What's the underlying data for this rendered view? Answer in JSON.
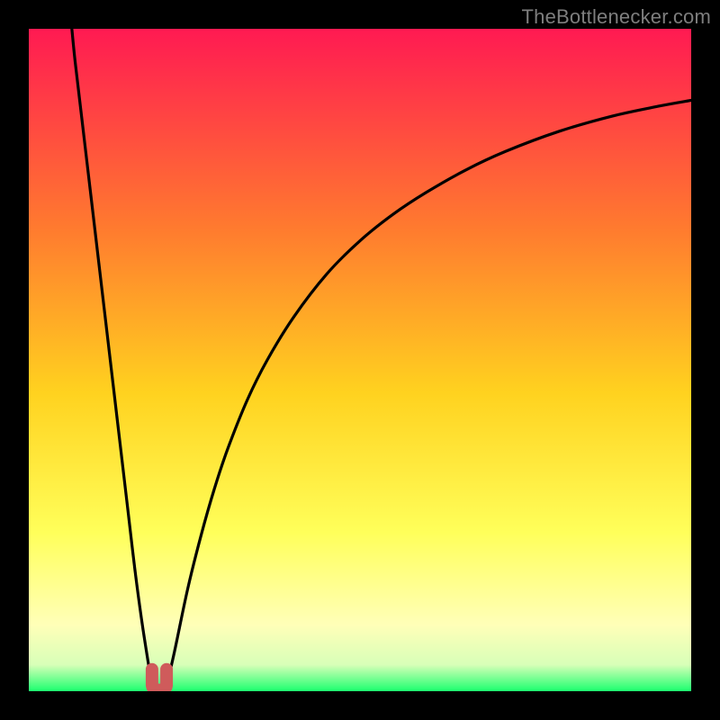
{
  "credit": "TheBottlenecker.com",
  "colors": {
    "frame": "#000000",
    "curve": "#000000",
    "marker_fill": "#cf5b5b",
    "marker_stroke": "#cf5b5b",
    "gradient_top": "#ff1a52",
    "gradient_mid1": "#ff7a2f",
    "gradient_mid2": "#ffd21f",
    "gradient_mid3": "#ffff5a",
    "gradient_mid4": "#ffffb8",
    "gradient_mid5": "#d8ffb8",
    "gradient_bottom": "#1cff6f"
  },
  "chart_data": {
    "type": "line",
    "title": "",
    "xlabel": "",
    "ylabel": "",
    "xlim": [
      0,
      100
    ],
    "ylim": [
      0,
      100
    ],
    "grid": false,
    "legend": false,
    "annotations": [],
    "series": [
      {
        "name": "left-branch",
        "x": [
          6.5,
          7,
          8,
          9,
          10,
          11,
          12,
          13,
          14,
          15,
          16,
          17,
          18,
          18.6
        ],
        "y": [
          100,
          95,
          86.5,
          78,
          69.5,
          61,
          52.5,
          44,
          35.5,
          27,
          18.5,
          11,
          4.5,
          0.8
        ]
      },
      {
        "name": "right-branch",
        "x": [
          20.8,
          22,
          24,
          26,
          28,
          30,
          33,
          36,
          40,
          45,
          50,
          55,
          60,
          66,
          72,
          80,
          88,
          95,
          100
        ],
        "y": [
          0.8,
          6,
          15.5,
          23.5,
          30.5,
          36.5,
          44,
          50,
          56.5,
          63,
          68,
          72,
          75.3,
          78.7,
          81.5,
          84.5,
          86.8,
          88.3,
          89.2
        ]
      }
    ],
    "minimum_marker": {
      "x_range": [
        18.6,
        20.8
      ],
      "y": 0.8,
      "shape": "u"
    }
  }
}
